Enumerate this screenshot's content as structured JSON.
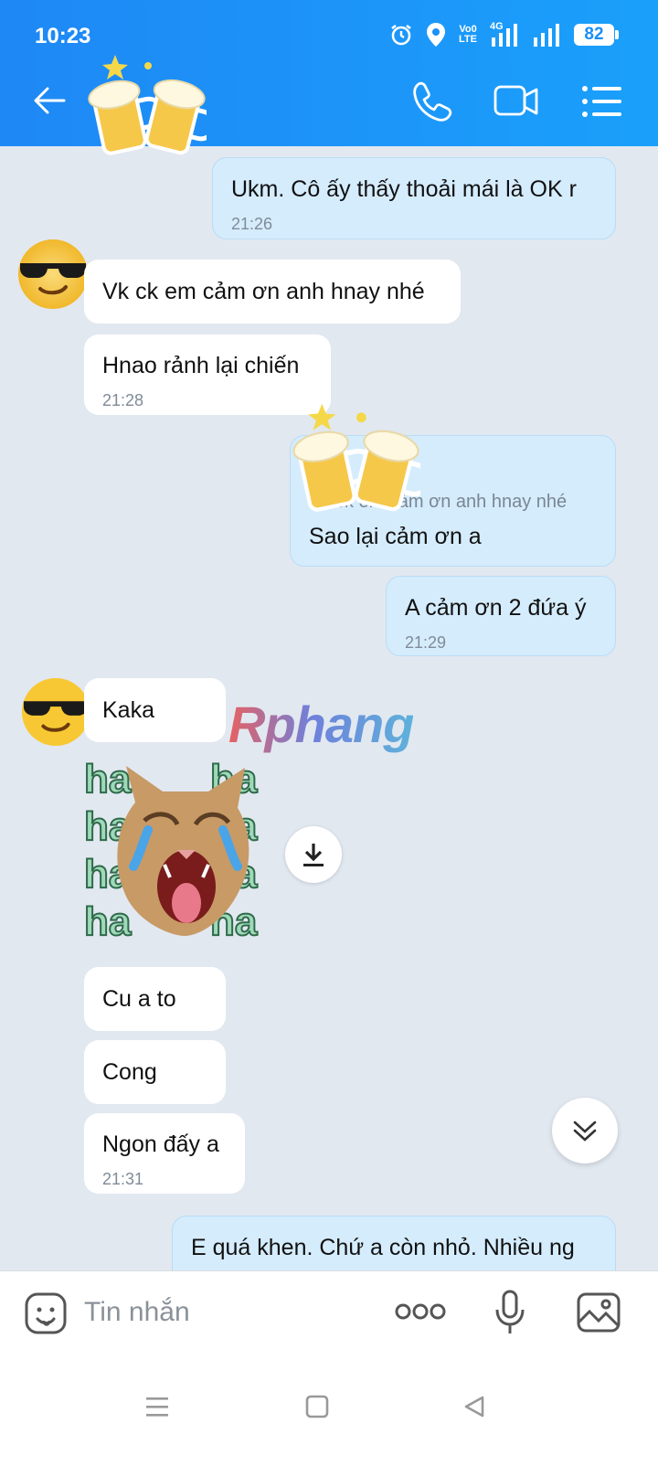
{
  "status_bar": {
    "time": "10:23",
    "network_top": "Vo0",
    "network_bottom": "LTE",
    "net_type": "4G",
    "battery": "82"
  },
  "header": {
    "icons": [
      "back-arrow-icon",
      "phone-icon",
      "video-call-icon",
      "menu-list-icon"
    ],
    "accent": "#1e88f5"
  },
  "messages": [
    {
      "direction": "out",
      "text": "Ukm. Cô ấy thấy thoải mái là OK r",
      "time": "21:26"
    },
    {
      "direction": "in",
      "text": "Vk ck em cảm ơn anh hnay nhé",
      "time": ""
    },
    {
      "direction": "in",
      "text": "Hnao rảnh lại chiến",
      "time": "21:28"
    },
    {
      "direction": "out",
      "quote": "Vk ck em cảm ơn anh hnay nhé",
      "text": "Sao lại cảm ơn a",
      "time": ""
    },
    {
      "direction": "out",
      "text": "A cảm ơn 2 đứa ý",
      "time": "21:29"
    },
    {
      "direction": "in",
      "text": "Kaka",
      "time": ""
    },
    {
      "direction": "in",
      "sticker": "laughing-cat-haha-sticker",
      "sticker_text": "ha"
    },
    {
      "direction": "in",
      "text": "Cu a to",
      "time": ""
    },
    {
      "direction": "in",
      "text": "Cong",
      "time": ""
    },
    {
      "direction": "in",
      "text": "Ngon đấy a",
      "time": "21:31"
    },
    {
      "direction": "out",
      "text": "E quá khen. Chứ a còn nhỏ. Nhiều ng",
      "time": ""
    }
  ],
  "watermark": "Rphang",
  "input_bar": {
    "placeholder": "Tin nhắn"
  }
}
